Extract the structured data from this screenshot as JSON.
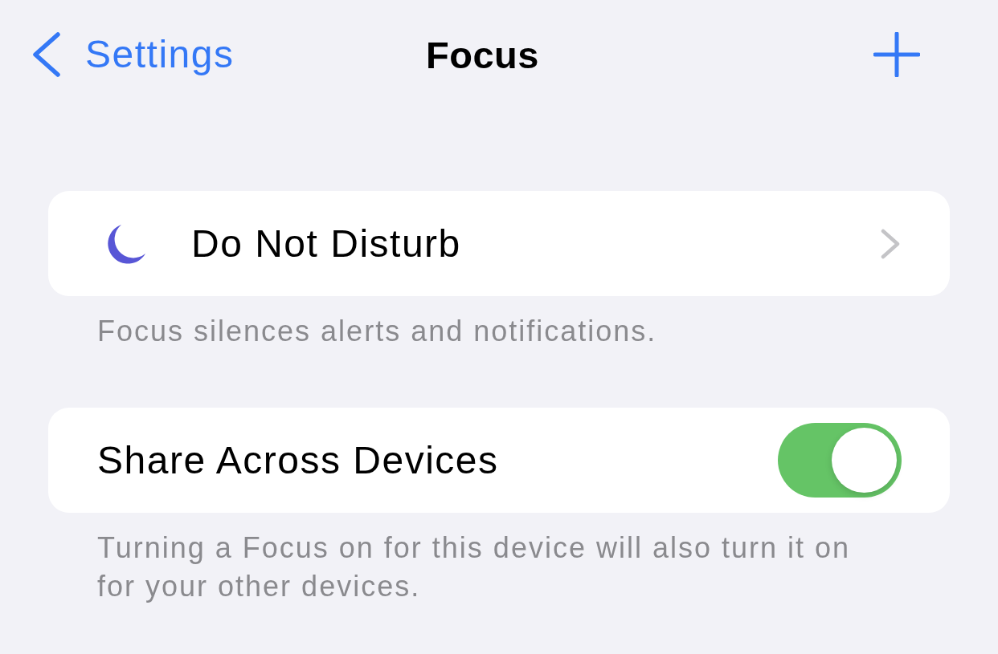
{
  "nav_bar": {
    "back_label": "Settings",
    "title": "Focus"
  },
  "sections": [
    {
      "rows": [
        {
          "kind": "focus_mode",
          "label": "Do Not Disturb"
        }
      ],
      "footer": "Focus silences alerts and notifications."
    },
    {
      "rows": [
        {
          "kind": "toggle",
          "label": "Share Across Devices",
          "on": true
        }
      ],
      "footer": "Turning a Focus on for this device will also turn it on for your other devices."
    }
  ]
}
